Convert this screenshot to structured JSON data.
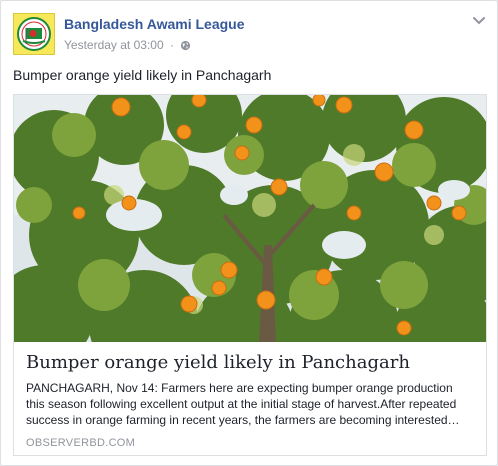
{
  "post": {
    "page_name": "Bangladesh Awami League",
    "timestamp": "Yesterday at 03:00",
    "separator": "·",
    "privacy_icon": "globe-icon",
    "menu_icon": "chevron-down-icon",
    "text": "Bumper orange yield likely in Panchagarh"
  },
  "link_preview": {
    "title": "Bumper orange yield likely in Panchagarh",
    "description": "PANCHAGARH, Nov 14: Farmers here are expecting bumper orange production this season following excellent output at the initial stage of harvest.After repeated success in orange farming in recent years, the farmers are becoming interested…",
    "domain": "OBSERVERBD.COM"
  },
  "colors": {
    "link_blue": "#365899",
    "meta_gray": "#90949c",
    "text": "#1d2129",
    "border": "#dddfe2",
    "avatar_yellow": "#f6e85a",
    "logo_green": "#1e8a3a",
    "logo_red": "#d62d2d"
  }
}
